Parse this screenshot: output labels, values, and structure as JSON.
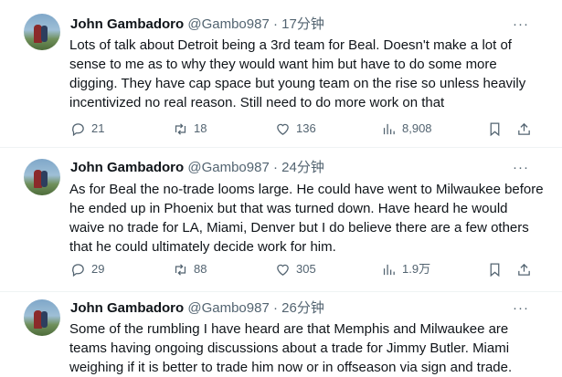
{
  "tweets": [
    {
      "name": "John Gambadoro",
      "handle": "@Gambo987",
      "time": " · 17分钟",
      "text": "Lots of talk about Detroit being a 3rd team for Beal. Doesn't make a lot of sense to me as to why they would want him but have to do some more digging. They have cap space but young team on the rise so unless heavily incentivized no real reason. Still need to do more work on that",
      "replies": "21",
      "retweets": "18",
      "likes": "136",
      "views": "8,908"
    },
    {
      "name": "John Gambadoro",
      "handle": "@Gambo987",
      "time": " · 24分钟",
      "text": "As for Beal the no-trade looms large. He could have went to Milwaukee before he ended up in Phoenix but that was turned down. Have heard he would waive no trade for LA, Miami, Denver but I do believe there are a few others that he could ultimately decide work for him.",
      "replies": "29",
      "retweets": "88",
      "likes": "305",
      "views": "1.9万"
    },
    {
      "name": "John Gambadoro",
      "handle": "@Gambo987",
      "time": " · 26分钟",
      "text": "Some of the rumbling I have heard are that Memphis and Milwaukee are teams having ongoing discussions about a trade for Jimmy Butler. Miami weighing if it is better to trade him now or in offseason via sign and trade."
    }
  ],
  "icons": {
    "more": "more-dots-icon",
    "reply": "reply-icon",
    "retweet": "retweet-icon",
    "like": "heart-icon",
    "views": "views-chart-icon",
    "bookmark": "bookmark-icon",
    "share": "share-icon"
  },
  "more_glyph": "···"
}
